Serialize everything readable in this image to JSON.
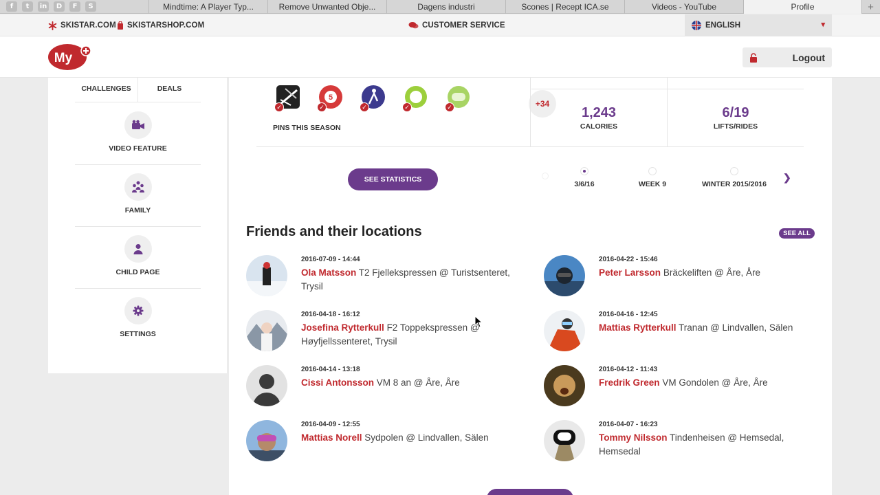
{
  "browser": {
    "pinned_tabs": [
      {
        "icon": "facebook-icon",
        "glyph": "f"
      },
      {
        "icon": "twitter-icon",
        "glyph": "t"
      },
      {
        "icon": "linkedin-icon",
        "glyph": "in"
      },
      {
        "icon": "d-icon",
        "glyph": "D"
      },
      {
        "icon": "f-icon",
        "glyph": "F"
      },
      {
        "icon": "s-icon",
        "glyph": "S"
      }
    ],
    "tabs": [
      {
        "label": "Mindtime: A Player Typ..."
      },
      {
        "label": "Remove Unwanted Obje..."
      },
      {
        "label": "Dagens industri"
      },
      {
        "label": "Scones | Recept ICA.se"
      },
      {
        "label": "Videos - YouTube"
      },
      {
        "label": "Profile"
      }
    ],
    "new_tab": "+"
  },
  "topbar": {
    "skistar": "SKISTAR.COM",
    "shop": "SKISTARSHOP.COM",
    "customer_service": "CUSTOMER SERVICE",
    "language": "ENGLISH"
  },
  "header": {
    "logo_text": "My",
    "logout": "Logout"
  },
  "sidebar": {
    "challenges": "CHALLENGES",
    "deals": "DEALS",
    "items": [
      {
        "label": "VIDEO FEATURE",
        "icon": "video-camera-icon"
      },
      {
        "label": "FAMILY",
        "icon": "family-icon"
      },
      {
        "label": "CHILD PAGE",
        "icon": "person-icon"
      },
      {
        "label": "SETTINGS",
        "icon": "gear-icon"
      }
    ]
  },
  "stats": {
    "pins_label": "PINS THIS SEASON",
    "more_pins": "+34",
    "calories_value": "1,243",
    "calories_label": "CALORIES",
    "lifts_value": "6/19",
    "lifts_label": "LIFTS/RIDES",
    "see_statistics": "SEE STATISTICS",
    "periods": [
      {
        "label": "3/6/16"
      },
      {
        "label": "WEEK 9"
      },
      {
        "label": "WINTER 2015/2016"
      }
    ]
  },
  "friends": {
    "title": "Friends and their locations",
    "see_all": "SEE ALL",
    "items": [
      {
        "time": "2016-07-09 - 14:44",
        "name": "Ola Matsson",
        "location": "T2 Fjellekspressen @ Turistsenteret, Trysil"
      },
      {
        "time": "2016-04-22 - 15:46",
        "name": "Peter Larsson",
        "location": "Bräckeliften @ Åre, Åre"
      },
      {
        "time": "2016-04-18 - 16:12",
        "name": "Josefina Rytterkull",
        "location": "F2 Toppekspressen @ Høyfjellssenteret, Trysil"
      },
      {
        "time": "2016-04-16 - 12:45",
        "name": "Mattias Rytterkull",
        "location": "Tranan @ Lindvallen, Sälen"
      },
      {
        "time": "2016-04-14 - 13:18",
        "name": "Cissi Antonsson",
        "location": "VM 8 an @ Åre, Åre"
      },
      {
        "time": "2016-04-12 - 11:43",
        "name": "Fredrik Green",
        "location": "VM Gondolen @ Åre, Åre"
      },
      {
        "time": "2016-04-09 - 12:55",
        "name": "Mattias Norell",
        "location": "Sydpolen @ Lindvallen, Sälen"
      },
      {
        "time": "2016-04-07 - 16:23",
        "name": "Tommy Nilsson",
        "location": "Tindenheisen @ Hemsedal, Hemsedal"
      }
    ]
  },
  "colors": {
    "accent_purple": "#6b3b8c",
    "accent_red": "#c0292e"
  }
}
